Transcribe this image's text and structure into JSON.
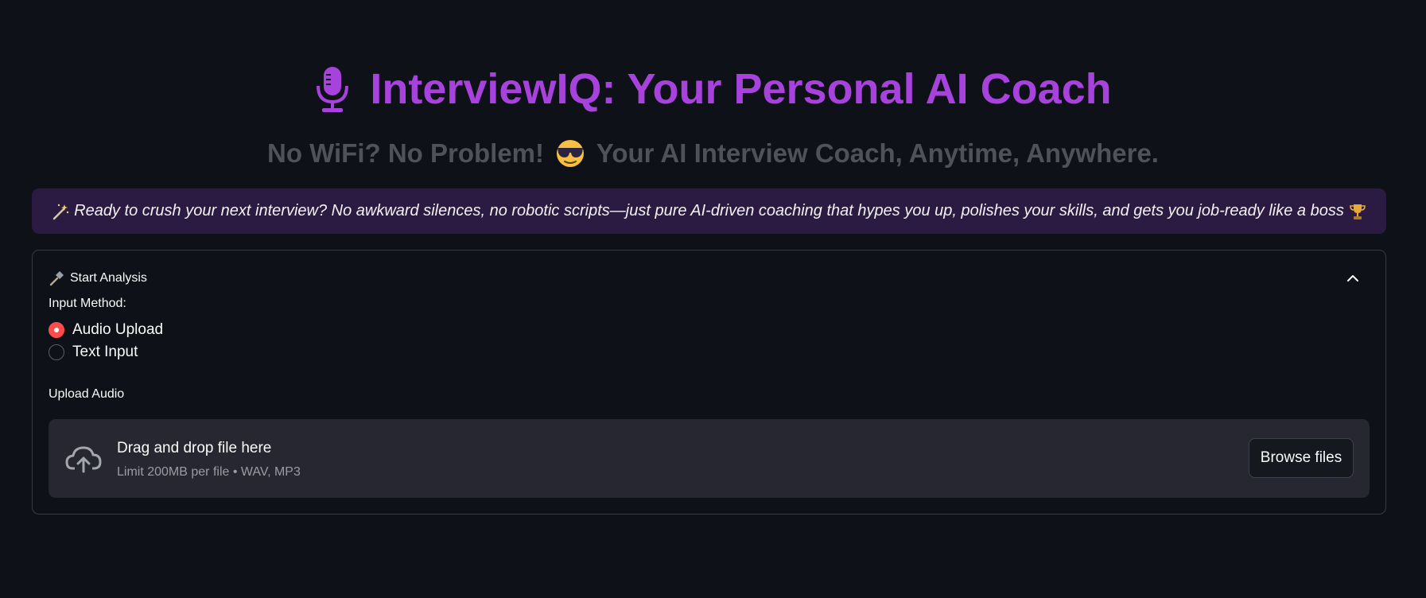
{
  "header": {
    "mic_icon": "microphone-icon",
    "title": "InterviewIQ: Your Personal AI Coach",
    "title_color": "#a742dc"
  },
  "subtitle": {
    "part1": "No WiFi? No Problem!",
    "emoji": "sunglasses-face-emoji",
    "part2": "Your AI Interview Coach, Anytime, Anywhere."
  },
  "banner": {
    "leading_icon": "magic-wand-icon",
    "text": "Ready to crush your next interview? No awkward silences, no robotic scripts—just pure AI-driven coaching that hypes you up, polishes your skills, and gets you job-ready like a boss",
    "trailing_icon": "trophy-icon",
    "background": "#2b1a42"
  },
  "expander": {
    "icon": "hammer-icon",
    "label": "Start Analysis",
    "toggle_icon": "chevron-up-icon"
  },
  "input_method": {
    "label": "Input Method:",
    "options": [
      {
        "label": "Audio Upload",
        "selected": true
      },
      {
        "label": "Text Input",
        "selected": false
      }
    ],
    "accent": "#ff4b4b"
  },
  "upload": {
    "label": "Upload Audio",
    "icon": "cloud-upload-icon",
    "drag_text": "Drag and drop file here",
    "limit_text": "Limit 200MB per file • WAV, MP3",
    "browse_label": "Browse files"
  }
}
